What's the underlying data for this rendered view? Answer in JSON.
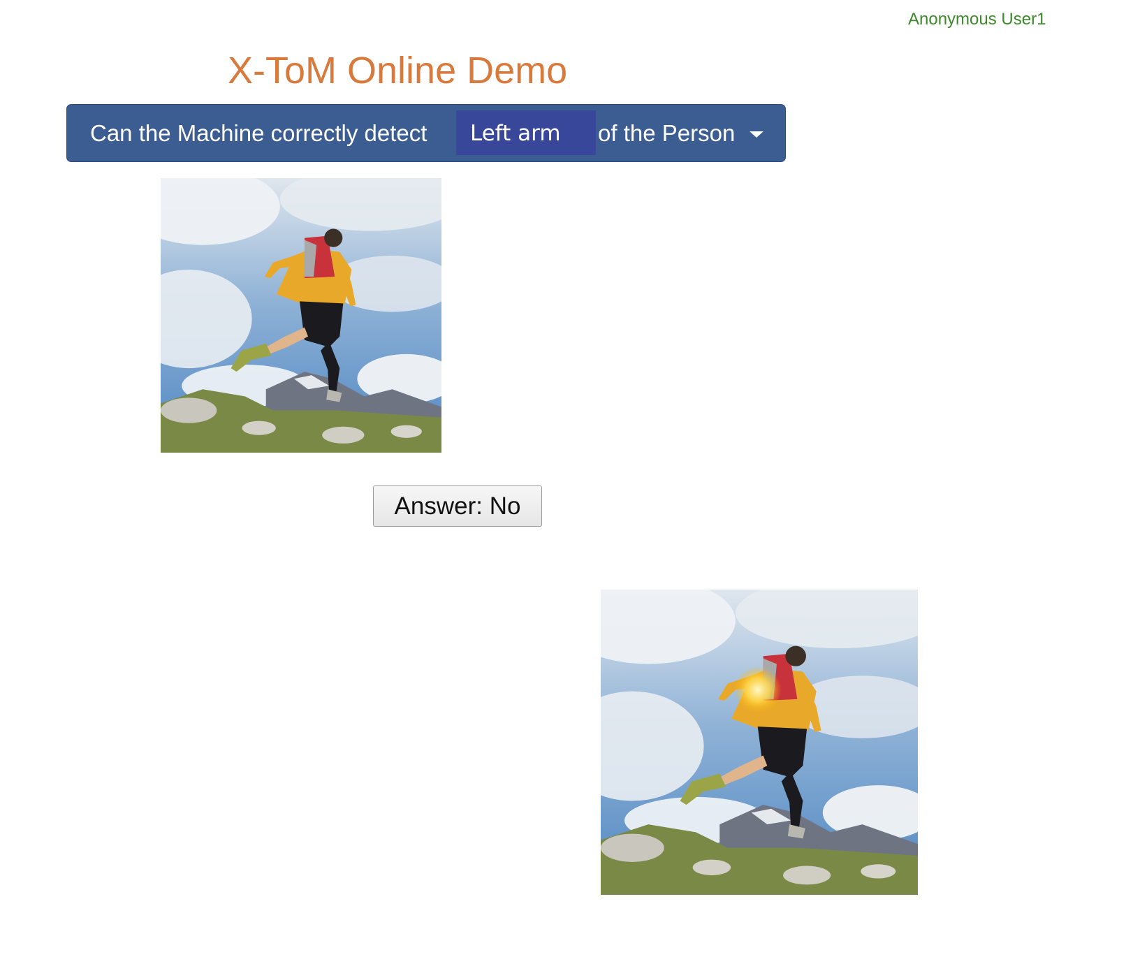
{
  "header": {
    "user_name": "Anonymous User1",
    "title": "X-ToM Online Demo"
  },
  "question": {
    "prefix": "Can the Machine correctly detect",
    "selected_part": "Left arm",
    "suffix": "of the Person"
  },
  "answer_button_label": "Answer: No",
  "icons": {
    "dropdown": "caret-down-icon"
  },
  "colors": {
    "title": "#d77a3c",
    "user": "#3d8a2a",
    "question_bar": "#3b5d91",
    "selected_part_bg": "#39479a"
  }
}
